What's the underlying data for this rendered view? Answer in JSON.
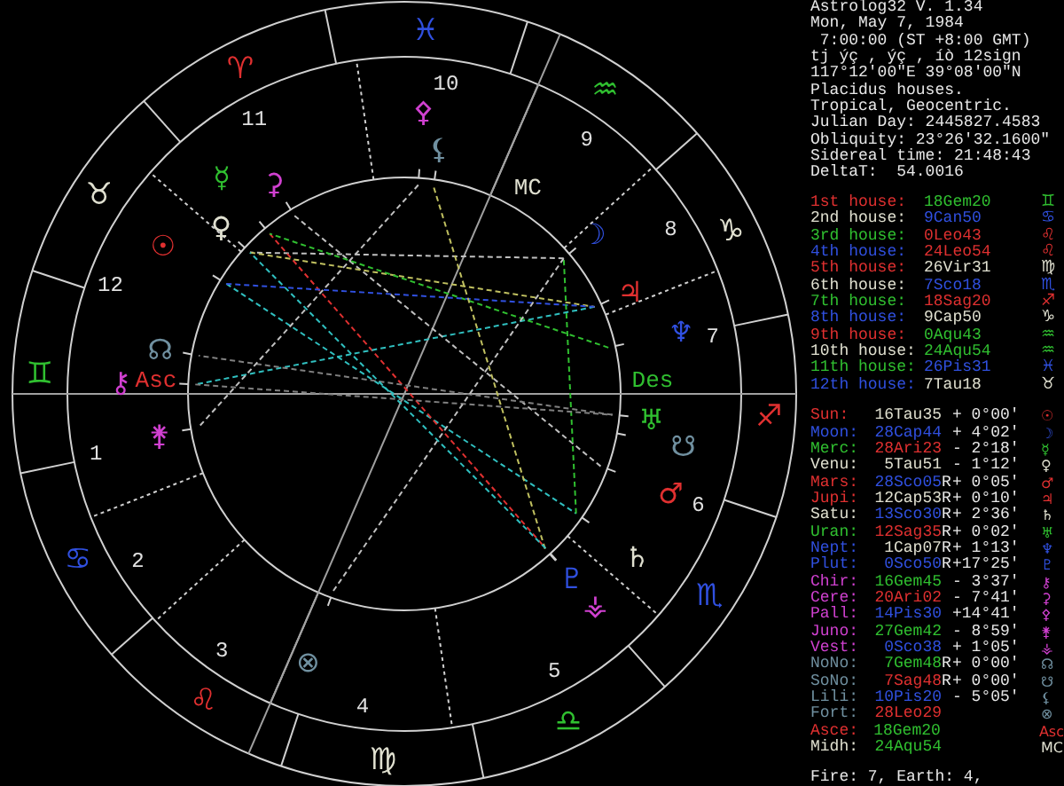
{
  "chart": {
    "signs": [
      {
        "glyph": "♈",
        "color": "#e03030"
      },
      {
        "glyph": "♉",
        "color": "#e0e0d0"
      },
      {
        "glyph": "♊",
        "color": "#30c030"
      },
      {
        "glyph": "♋",
        "color": "#3050e0"
      },
      {
        "glyph": "♌",
        "color": "#e03030"
      },
      {
        "glyph": "♍",
        "color": "#e0e0d0"
      },
      {
        "glyph": "♎",
        "color": "#30c030"
      },
      {
        "glyph": "♏",
        "color": "#3050e0"
      },
      {
        "glyph": "♐",
        "color": "#e03030"
      },
      {
        "glyph": "♑",
        "color": "#e0e0d0"
      },
      {
        "glyph": "♒",
        "color": "#30c030"
      },
      {
        "glyph": "♓",
        "color": "#3050e0"
      }
    ],
    "house_numbers": [
      "1",
      "2",
      "3",
      "4",
      "5",
      "6",
      "7",
      "8",
      "9",
      "10",
      "11",
      "12"
    ],
    "angles": [
      {
        "label": "Asc",
        "color": "#e03030"
      },
      {
        "label": "Des",
        "color": "#30c030"
      },
      {
        "label": "MC",
        "color": "#e0e0d0"
      }
    ],
    "planets": [
      {
        "glyph": "☉",
        "color": "#e03030"
      },
      {
        "glyph": "☽",
        "color": "#3050e0"
      },
      {
        "glyph": "☿",
        "color": "#30c030"
      },
      {
        "glyph": "♀",
        "color": "#e0e0d0"
      },
      {
        "glyph": "♂",
        "color": "#e03030"
      },
      {
        "glyph": "♃",
        "color": "#e03030"
      },
      {
        "glyph": "♄",
        "color": "#e0e0d0"
      },
      {
        "glyph": "♅",
        "color": "#30c030"
      },
      {
        "glyph": "♆",
        "color": "#3050e0"
      },
      {
        "glyph": "♇",
        "color": "#3050e0"
      },
      {
        "glyph": "⚷",
        "color": "#d040d0"
      },
      {
        "glyph": "⚳",
        "color": "#d040d0"
      },
      {
        "glyph": "⚴",
        "color": "#d040d0"
      },
      {
        "glyph": "⚵",
        "color": "#d040d0"
      },
      {
        "glyph": "⚶",
        "color": "#d040d0"
      },
      {
        "glyph": "☊",
        "color": "#7090a0"
      },
      {
        "glyph": "☋",
        "color": "#7090a0"
      },
      {
        "glyph": "⚸",
        "color": "#7090a0"
      },
      {
        "glyph": "⊗",
        "color": "#7090a0"
      }
    ]
  },
  "info": [
    "Astrolog32 V. 1.34",
    "Mon, May 7, 1984",
    " 7:00:00 (ST +8:00 GMT)",
    "tj ýç , ýç , íò 12sign",
    "117°12'00\"E 39°08'00\"N",
    "Placidus houses.",
    "Tropical, Geocentric.",
    "Julian Day: 2445827.4583",
    "Obliquity: 23°26'32.1600\"",
    "Sidereal time: 21:48:43",
    "DeltaT:  54.0016"
  ],
  "houses": [
    {
      "label": {
        "text": "1st house:",
        "color": "#e03030"
      },
      "position": {
        "text": "18Gem20",
        "color": "#30c030"
      },
      "glyph": "♊"
    },
    {
      "label": {
        "text": "2nd house:",
        "color": "#e0e0d0"
      },
      "position": {
        "text": "9Can50",
        "color": "#3050e0"
      },
      "glyph": "♋"
    },
    {
      "label": {
        "text": "3rd house:",
        "color": "#30c030"
      },
      "position": {
        "text": "0Leo43",
        "color": "#e03030"
      },
      "glyph": "♌"
    },
    {
      "label": {
        "text": "4th house:",
        "color": "#3050e0"
      },
      "position": {
        "text": "24Leo54",
        "color": "#e03030"
      },
      "glyph": "♌"
    },
    {
      "label": {
        "text": "5th house:",
        "color": "#e03030"
      },
      "position": {
        "text": "26Vir31",
        "color": "#e0e0d0"
      },
      "glyph": "♍"
    },
    {
      "label": {
        "text": "6th house:",
        "color": "#e0e0d0"
      },
      "position": {
        "text": "7Sco18",
        "color": "#3050e0"
      },
      "glyph": "♏"
    },
    {
      "label": {
        "text": "7th house:",
        "color": "#30c030"
      },
      "position": {
        "text": "18Sag20",
        "color": "#e03030"
      },
      "glyph": "♐"
    },
    {
      "label": {
        "text": "8th house:",
        "color": "#3050e0"
      },
      "position": {
        "text": "9Cap50",
        "color": "#e0e0d0"
      },
      "glyph": "♑"
    },
    {
      "label": {
        "text": "9th house:",
        "color": "#e03030"
      },
      "position": {
        "text": "0Aqu43",
        "color": "#30c030"
      },
      "glyph": "♒"
    },
    {
      "label": {
        "text": "10th house:",
        "color": "#e0e0d0"
      },
      "position": {
        "text": "24Aqu54",
        "color": "#30c030"
      },
      "glyph": "♒"
    },
    {
      "label": {
        "text": "11th house:",
        "color": "#30c030"
      },
      "position": {
        "text": "26Pis31",
        "color": "#3050e0"
      },
      "glyph": "♓"
    },
    {
      "label": {
        "text": "12th house:",
        "color": "#3050e0"
      },
      "position": {
        "text": "7Tau18",
        "color": "#e0e0d0"
      },
      "glyph": "♉"
    }
  ],
  "planets": [
    {
      "name": {
        "text": "Sun:",
        "color": "#e03030"
      },
      "position": {
        "text": "16Tau35",
        "color": "#e0e0d0"
      },
      "latitude": "+ 0°00'",
      "glyph": "☉"
    },
    {
      "name": {
        "text": "Moon:",
        "color": "#3050e0"
      },
      "position": {
        "text": "28Cap44",
        "color": "#3050e0"
      },
      "latitude": "+ 4°02'",
      "glyph": "☽"
    },
    {
      "name": {
        "text": "Merc:",
        "color": "#30c030"
      },
      "position": {
        "text": "28Ari23",
        "color": "#e03030"
      },
      "latitude": "- 2°18'",
      "glyph": "☿"
    },
    {
      "name": {
        "text": "Venu:",
        "color": "#e0e0d0"
      },
      "position": {
        "text": "5Tau51",
        "color": "#e0e0d0"
      },
      "latitude": "- 1°12'",
      "glyph": "♀"
    },
    {
      "name": {
        "text": "Mars:",
        "color": "#e03030"
      },
      "position": {
        "text": "28Sco05",
        "color": "#3050e0"
      },
      "retrograde": "R",
      "latitude": "+ 0°05'",
      "glyph": "♂"
    },
    {
      "name": {
        "text": "Jupi:",
        "color": "#e03030"
      },
      "position": {
        "text": "12Cap53",
        "color": "#e0e0d0"
      },
      "retrograde": "R",
      "latitude": "+ 0°10'",
      "glyph": "♃"
    },
    {
      "name": {
        "text": "Satu:",
        "color": "#e0e0d0"
      },
      "position": {
        "text": "13Sco30",
        "color": "#3050e0"
      },
      "retrograde": "R",
      "latitude": "+ 2°36'",
      "glyph": "♄"
    },
    {
      "name": {
        "text": "Uran:",
        "color": "#30c030"
      },
      "position": {
        "text": "12Sag35",
        "color": "#e03030"
      },
      "retrograde": "R",
      "latitude": "+ 0°02'",
      "glyph": "♅"
    },
    {
      "name": {
        "text": "Nept:",
        "color": "#3050e0"
      },
      "position": {
        "text": "1Cap07",
        "color": "#e0e0d0"
      },
      "retrograde": "R",
      "latitude": "+ 1°13'",
      "glyph": "♆"
    },
    {
      "name": {
        "text": "Plut:",
        "color": "#3050e0"
      },
      "position": {
        "text": "0Sco50",
        "color": "#3050e0"
      },
      "retrograde": "R",
      "latitude": "+17°25'",
      "glyph": "♇"
    },
    {
      "name": {
        "text": "Chir:",
        "color": "#d040d0"
      },
      "position": {
        "text": "16Gem45",
        "color": "#30c030"
      },
      "latitude": "- 3°37'",
      "glyph": "⚷"
    },
    {
      "name": {
        "text": "Cere:",
        "color": "#d040d0"
      },
      "position": {
        "text": "20Ari02",
        "color": "#e03030"
      },
      "latitude": "- 7°41'",
      "glyph": "⚳"
    },
    {
      "name": {
        "text": "Pall:",
        "color": "#d040d0"
      },
      "position": {
        "text": "14Pis30",
        "color": "#3050e0"
      },
      "latitude": "+14°41'",
      "glyph": "⚴"
    },
    {
      "name": {
        "text": "Juno:",
        "color": "#d040d0"
      },
      "position": {
        "text": "27Gem42",
        "color": "#30c030"
      },
      "latitude": "- 8°59'",
      "glyph": "⚵"
    },
    {
      "name": {
        "text": "Vest:",
        "color": "#d040d0"
      },
      "position": {
        "text": "0Sco38",
        "color": "#3050e0"
      },
      "latitude": "+ 1°05'",
      "glyph": "⚶"
    },
    {
      "name": {
        "text": "NoNo:",
        "color": "#7090a0"
      },
      "position": {
        "text": "7Gem48",
        "color": "#30c030"
      },
      "retrograde": "R",
      "latitude": "+ 0°00'",
      "glyph": "☊"
    },
    {
      "name": {
        "text": "SoNo:",
        "color": "#7090a0"
      },
      "position": {
        "text": "7Sag48",
        "color": "#e03030"
      },
      "retrograde": "R",
      "latitude": "+ 0°00'",
      "glyph": "☋"
    },
    {
      "name": {
        "text": "Lili:",
        "color": "#7090a0"
      },
      "position": {
        "text": "10Pis20",
        "color": "#3050e0"
      },
      "latitude": "- 5°05'",
      "glyph": "⚸"
    },
    {
      "name": {
        "text": "Fort:",
        "color": "#7090a0"
      },
      "position": {
        "text": "28Leo29",
        "color": "#e03030"
      },
      "glyph": "⊗"
    },
    {
      "name": {
        "text": "Asce:",
        "color": "#e03030"
      },
      "position": {
        "text": "18Gem20",
        "color": "#30c030"
      },
      "glyph": "Asc"
    },
    {
      "name": {
        "text": "Midh:",
        "color": "#e0e0d0"
      },
      "position": {
        "text": "24Aqu54",
        "color": "#30c030"
      },
      "glyph": "MC"
    }
  ],
  "elements": "Fire: 7, Earth: 4,"
}
